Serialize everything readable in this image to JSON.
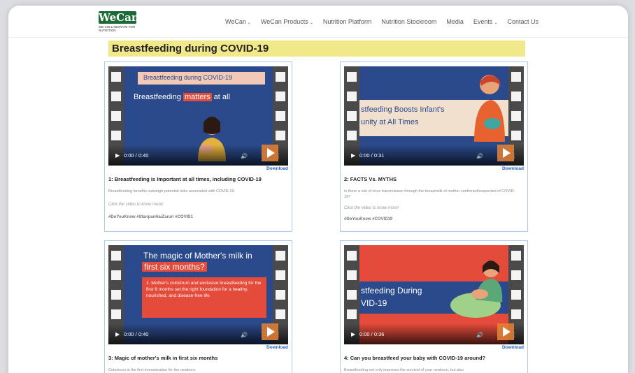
{
  "header": {
    "logo_text": "WeCan",
    "logo_tagline": "WE COLLABORATE FOR NUTRITION",
    "nav": [
      {
        "label": "WeCan",
        "dropdown": true
      },
      {
        "label": "WeCan Products",
        "dropdown": true
      },
      {
        "label": "Nutrition Platform",
        "dropdown": false
      },
      {
        "label": "Nutrition Stockroom",
        "dropdown": false
      },
      {
        "label": "Media",
        "dropdown": false
      },
      {
        "label": "Events",
        "dropdown": true
      },
      {
        "label": "Contact Us",
        "dropdown": false
      }
    ]
  },
  "page_title": "Breastfeeding during COVID-19",
  "colors": {
    "accent": "#f1e88a",
    "brand": "#1b6b36",
    "link": "#1f5fbf",
    "card_border": "#a9cbef"
  },
  "cards": [
    {
      "video_line1": "Breastfeeding during COVID-19",
      "video_line2a": "Breastfeeding ",
      "video_line2b": "matters",
      "video_line2c": " at all",
      "time": "0:00 / 0:40",
      "download": "Download",
      "title": "1: Breastfeeding is Important at all times, including COVID-19",
      "desc": "Breastfeeding benefits outweigh potential risks associated with COVID-19.",
      "know_more": "Click the video to know more!",
      "tags": "#DoYouKnow  #StanpanHaiZaruri  #COVID1"
    },
    {
      "video_line1": "stfeeding Boosts Infant's",
      "video_line2": "unity at All Times",
      "time": "0:00 / 0:31",
      "download": "Download",
      "title": "2: FACTS Vs. MYTHS",
      "desc": "Is there a risk of virus transmission through the breastmilk of mother confirmed/suspected of COVID-19?",
      "know_more": "Click the video to know more!",
      "tags": "#DoYouKnow  #COVID19"
    },
    {
      "video_line1a": "The magic of Mother's milk in",
      "video_line1b": "first six months?",
      "video_body": "1.   Mother's colostrum and exclusive breastfeeding for the first 6 months set the right foundation for a healthy, nourished, and disease-free life",
      "time": "0:00 / 0:40",
      "download": "Download",
      "title": "3: Magic of mother's milk in first six months",
      "desc": "Colostrum is the first immunization for the newborn."
    },
    {
      "video_line1": "stfeeding During",
      "video_line2": "VID-19",
      "time": "0:00 / 0:36",
      "download": "Download",
      "title": "4: Can you breastfeed your baby with COVID-19 around?",
      "desc": "Breastfeeding not only improves the survival of your newborn, but also"
    }
  ]
}
